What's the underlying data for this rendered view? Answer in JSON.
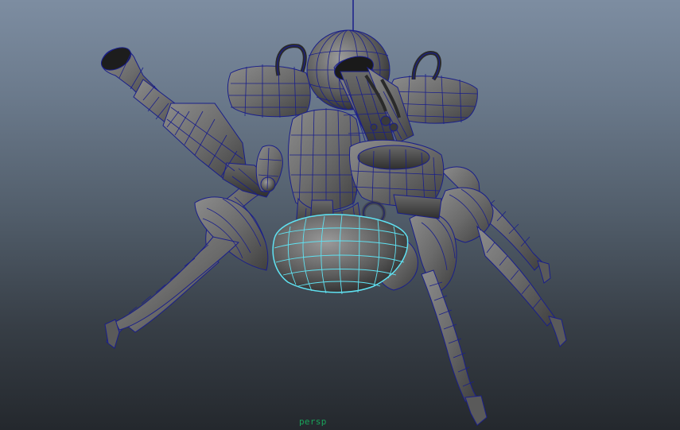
{
  "viewport": {
    "camera_label": "persp",
    "background_top_color": "#7d8da1",
    "background_bottom_color": "#24282d",
    "wire_color": "#1a1f8a",
    "selected_wire_color": "#5fe2f2",
    "shaded_color": "#707070",
    "model_icon": "mech-spider-robot-model"
  }
}
